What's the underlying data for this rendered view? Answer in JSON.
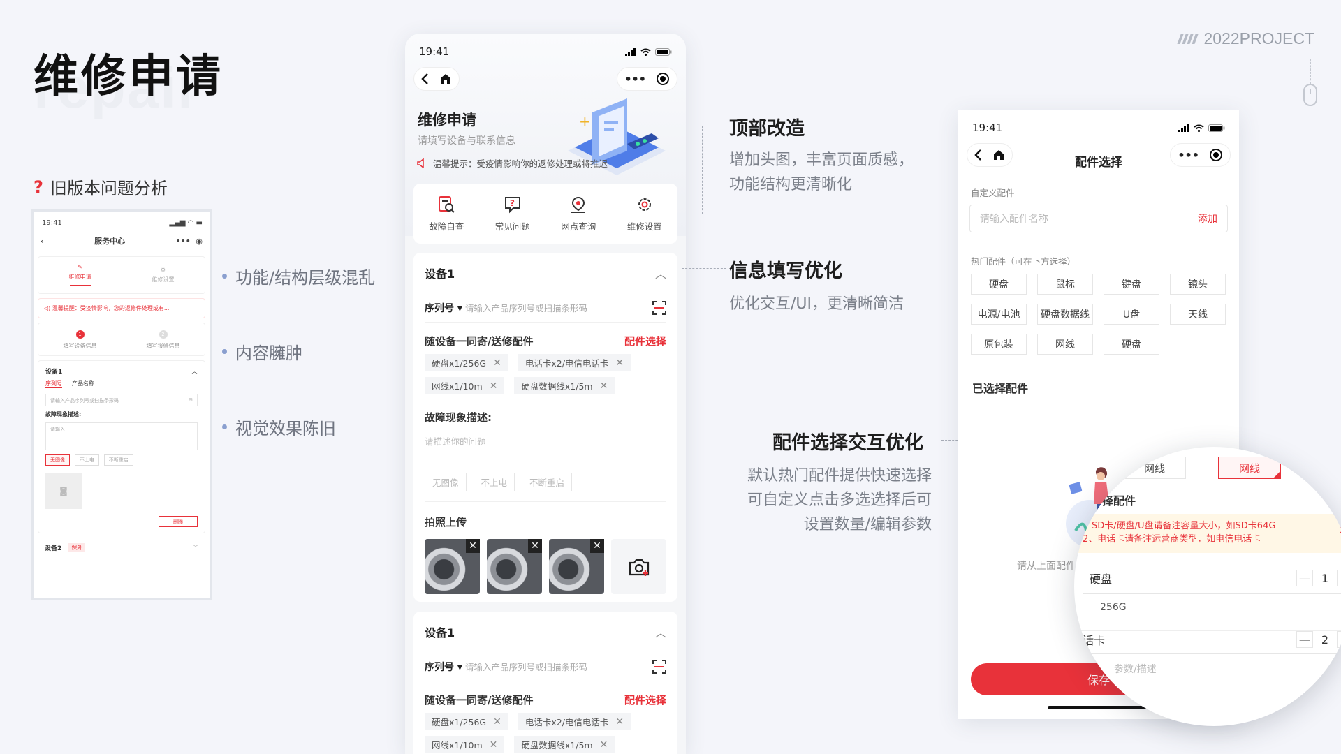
{
  "page": {
    "title": "维修申请",
    "bg_word": "repair",
    "brand": "2022PROJECT",
    "old_heading": "旧版本问题分析",
    "bullets": [
      "功能/结构层级混乱",
      "内容臃肿",
      "视觉效果陈旧"
    ]
  },
  "old_app": {
    "time": "19:41",
    "title": "服务中心",
    "tabs": [
      "维修申请",
      "维修设置"
    ],
    "notice": "温馨提醒：受疫情影响，您的返修件处理或有...",
    "steps": [
      {
        "num": "1",
        "label": "填写设备信息"
      },
      {
        "num": "2",
        "label": "填写报修信息"
      }
    ],
    "device": "设备1",
    "sub_tabs": [
      "序列号",
      "产品名称"
    ],
    "input_placeholder": "请输入产品序列号或扫描条形码",
    "fault_label": "故障现象描述:",
    "fault_placeholder": "请输入",
    "tags": [
      "无图像",
      "不上电",
      "不断重启"
    ],
    "delete": "删除",
    "device2": "设备2",
    "device2_badge": "保外"
  },
  "main_app": {
    "time": "19:41",
    "title": "维修申请",
    "subtitle": "请填写设备与联系信息",
    "notice": "温馨提示：受疫情影响你的返修处理或将推迟",
    "quick": [
      "故障自查",
      "常见问题",
      "网点查询",
      "维修设置"
    ],
    "devices": [
      {
        "name": "设备1",
        "serial_label": "序列号",
        "serial_placeholder": "请输入产品序列号或扫描条形码",
        "acc_label": "随设备一同寄/送修配件",
        "acc_link": "配件选择",
        "chips": [
          "硬盘x1/256G",
          "电话卡x2/电信电话卡",
          "网线x1/10m",
          "硬盘数据线x1/5m"
        ],
        "fault_label": "故障现象描述:",
        "fault_placeholder": "请描述你的问题",
        "fault_tags": [
          "无图像",
          "不上电",
          "不断重启"
        ],
        "photo_label": "拍照上传"
      },
      {
        "name": "设备1",
        "serial_label": "序列号",
        "serial_placeholder": "请输入产品序列号或扫描条形码",
        "acc_label": "随设备一同寄/送修配件",
        "acc_link": "配件选择",
        "chips": [
          "硬盘x1/256G",
          "电话卡x2/电信电话卡",
          "网线x1/10m",
          "硬盘数据线x1/5m"
        ]
      }
    ]
  },
  "annotations": [
    {
      "title": "顶部改造",
      "lines": [
        "增加头图，丰富页面质感，",
        "功能结构更清晰化"
      ]
    },
    {
      "title": "信息填写优化",
      "lines": [
        "优化交互/UI，更清晰简洁"
      ]
    },
    {
      "title": "配件选择交互优化",
      "lines": [
        "默认热门配件提供快速选择",
        "可自定义点击多选选择后可",
        "设置数量/编辑参数"
      ]
    }
  ],
  "parts_app": {
    "time": "19:41",
    "title": "配件选择",
    "custom_label": "自定义配件",
    "custom_placeholder": "请输入配件名称",
    "add": "添加",
    "hot_label": "热门配件（可在下方选择）",
    "hot_items": [
      "硬盘",
      "鼠标",
      "键盘",
      "镜头",
      "电源/电池",
      "硬盘数据线",
      "U盘",
      "天线",
      "原包装",
      "网线",
      "硬盘"
    ],
    "selected_label": "已选择配件",
    "empty_text": "请从上面配件",
    "save": "保存"
  },
  "magnifier": {
    "tabs": [
      "网线",
      "网线"
    ],
    "section": "择配件",
    "tips": [
      "、SD卡/硬盘/U盘请备注容量大小，如SD卡64G",
      "2、电话卡请备注运营商类型，如电信电话卡"
    ],
    "rows": [
      {
        "name": "硬盘",
        "qty": "1",
        "field": "256G"
      },
      {
        "name": "话卡",
        "qty": "2",
        "field": "参数/描述"
      }
    ]
  },
  "colors": {
    "accent": "#e8323a",
    "bg": "#f4f5fa"
  }
}
